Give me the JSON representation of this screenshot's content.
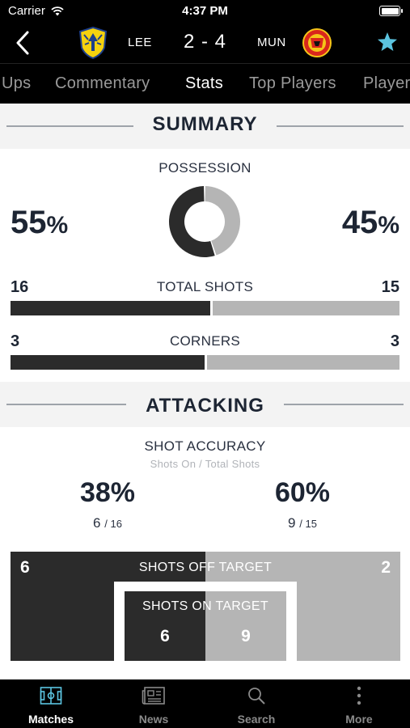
{
  "status_bar": {
    "carrier": "Carrier",
    "time": "4:37 PM"
  },
  "match": {
    "home_code": "LEE",
    "away_code": "MUN",
    "score": "2 - 4",
    "home_logo_icon": "leeds-crest-icon",
    "away_logo_icon": "man-united-crest-icon",
    "favorite_icon": "star-icon",
    "favorite_color": "#5bc4e0"
  },
  "tabs": [
    {
      "label": "Ups"
    },
    {
      "label": "Commentary"
    },
    {
      "label": "Stats",
      "active": true
    },
    {
      "label": "Top Players"
    },
    {
      "label": "Players"
    }
  ],
  "summary": {
    "title": "SUMMARY",
    "possession": {
      "label": "POSSESSION",
      "home_value": "55",
      "away_value": "45",
      "unit": "%",
      "home_fraction": 0.55
    },
    "total_shots": {
      "label": "TOTAL SHOTS",
      "home": "16",
      "away": "15",
      "home_fraction": 0.516
    },
    "corners": {
      "label": "CORNERS",
      "home": "3",
      "away": "3",
      "home_fraction": 0.5
    }
  },
  "attacking": {
    "title": "ATTACKING",
    "shot_accuracy": {
      "label": "SHOT ACCURACY",
      "sublabel": "Shots On / Total Shots",
      "home_pct": "38%",
      "away_pct": "60%",
      "home_on": "6",
      "home_total": "/ 16",
      "away_on": "9",
      "away_total": "/ 15"
    },
    "shots_off_target": {
      "label": "SHOTS OFF TARGET",
      "home": "6",
      "away": "2"
    },
    "shots_on_target": {
      "label": "SHOTS ON TARGET",
      "home": "6",
      "away": "9"
    }
  },
  "colors": {
    "home": "#2b2b2b",
    "away": "#b5b5b5",
    "text": "#1d2533"
  },
  "bottom_nav": [
    {
      "label": "Matches",
      "icon": "pitch-icon",
      "active": true
    },
    {
      "label": "News",
      "icon": "newspaper-icon"
    },
    {
      "label": "Search",
      "icon": "search-icon"
    },
    {
      "label": "More",
      "icon": "more-vertical-icon"
    }
  ]
}
